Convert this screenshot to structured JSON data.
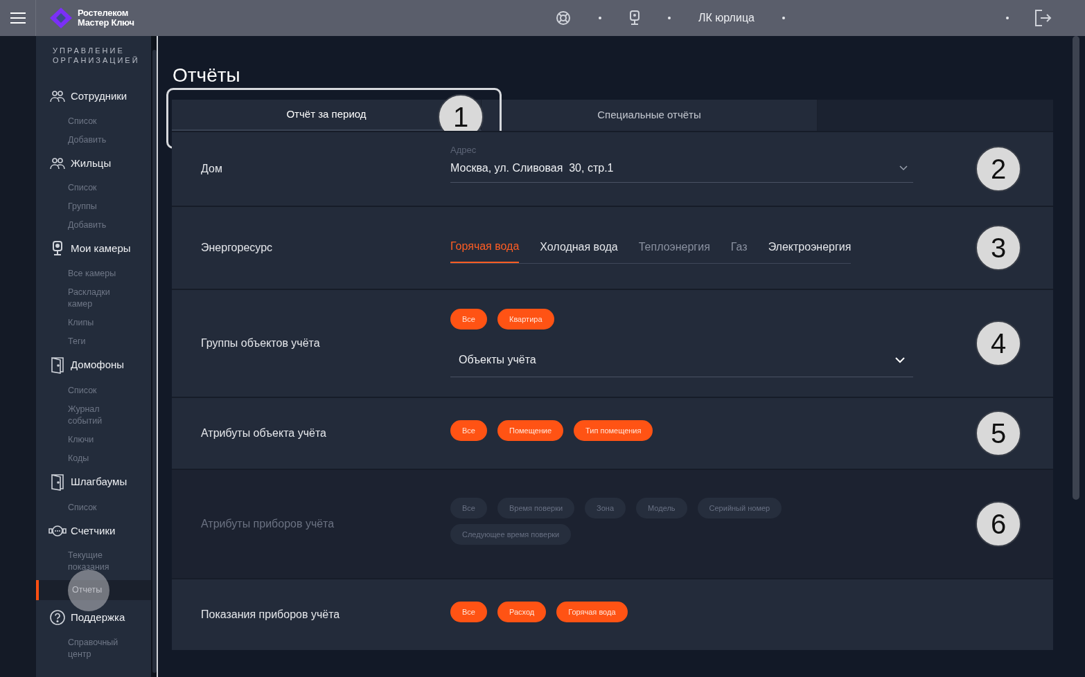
{
  "topbar": {
    "brand": [
      "Ростелеком",
      "Мастер Ключ"
    ],
    "account": "ЛК юрлица"
  },
  "sidebar": {
    "heading": "УПРАВЛЕНИЕ ОРГАНИЗАЦИЕЙ",
    "sections": [
      {
        "label": "Сотрудники",
        "items": [
          {
            "label": "Список",
            "selected": false
          },
          {
            "label": "Добавить",
            "selected": false
          }
        ]
      },
      {
        "label": "Жильцы",
        "items": [
          {
            "label": "Список",
            "selected": false
          },
          {
            "label": "Группы",
            "selected": false
          },
          {
            "label": "Добавить",
            "selected": false
          }
        ]
      },
      {
        "label": "Мои камеры",
        "items": [
          {
            "label": "Все камеры",
            "selected": false
          },
          {
            "label": "Раскладки камер",
            "selected": false
          },
          {
            "label": "Клипы",
            "selected": false
          },
          {
            "label": "Теги",
            "selected": false
          }
        ]
      },
      {
        "label": "Домофоны",
        "items": [
          {
            "label": "Список",
            "selected": false
          },
          {
            "label": "Журнал событий",
            "selected": false
          },
          {
            "label": "Ключи",
            "selected": false
          },
          {
            "label": "Коды",
            "selected": false
          }
        ]
      },
      {
        "label": "Шлагбаумы",
        "items": [
          {
            "label": "Список",
            "selected": false
          }
        ]
      },
      {
        "label": "Счетчики",
        "items": [
          {
            "label": "Текущие показания",
            "selected": false
          },
          {
            "label": "Отчеты",
            "selected": true
          }
        ]
      },
      {
        "label": "Поддержка",
        "items": [
          {
            "label": "Справочный центр",
            "selected": false
          }
        ]
      }
    ]
  },
  "page": {
    "title": "Отчёты",
    "tabs": [
      {
        "label": "Отчёт за период",
        "selected": true
      },
      {
        "label": "Специальные отчёты",
        "selected": false
      }
    ],
    "tabs_callout": "1",
    "rows": [
      {
        "kind": "address",
        "label": "Дом",
        "field_label": "Адрес",
        "value": "Москва, ул. Сливовая  30, стр.1",
        "callout": "2"
      },
      {
        "kind": "resource",
        "label": "Энергоресурс",
        "options": [
          {
            "label": "Горячая вода",
            "selected": true,
            "disabled": false
          },
          {
            "label": "Холодная вода",
            "selected": false,
            "disabled": false
          },
          {
            "label": "Теплоэнергия",
            "selected": false,
            "disabled": true
          },
          {
            "label": "Газ",
            "selected": false,
            "disabled": true
          },
          {
            "label": "Электроэнергия",
            "selected": false,
            "disabled": false
          }
        ],
        "callout": "3"
      },
      {
        "kind": "chips",
        "label": "Группы объектов учёта",
        "disabled": false,
        "chips": [
          "Все",
          "Квартира"
        ],
        "select": "Объекты учёта",
        "callout": "4"
      },
      {
        "kind": "chips",
        "label": "Атрибуты объекта учёта",
        "disabled": false,
        "chips": [
          "Все",
          "Помещение",
          "Тип помещения"
        ],
        "callout": "5"
      },
      {
        "kind": "chips",
        "label": "Атрибуты приборов учёта",
        "disabled": true,
        "chips": [
          "Все",
          "Время поверки",
          "Зона",
          "Модель",
          "Серийный номер",
          "Следующее время поверки"
        ],
        "callout": "6"
      },
      {
        "kind": "chips",
        "label": "Показания приборов учёта",
        "disabled": false,
        "chips": [
          "Все",
          "Расход",
          "Горячая вода"
        ]
      }
    ]
  }
}
